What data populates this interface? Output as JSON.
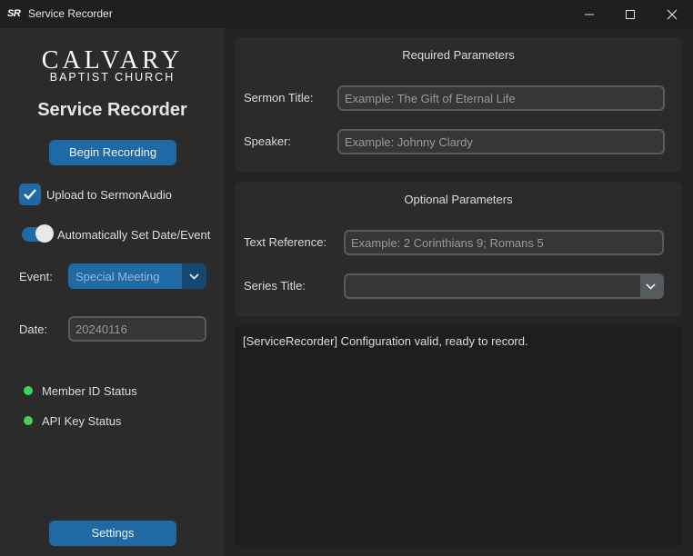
{
  "window": {
    "icon_text": "SR",
    "title": "Service Recorder"
  },
  "sidebar": {
    "logo_top": "CALVARY",
    "logo_bottom": "BAPTIST CHURCH",
    "heading": "Service Recorder",
    "begin_button": "Begin Recording",
    "upload_checkbox": {
      "label": "Upload to SermonAudio",
      "checked": true
    },
    "auto_switch": {
      "label": "Automatically Set Date/Event",
      "on": true
    },
    "event": {
      "label": "Event:",
      "value": "Special Meeting"
    },
    "date": {
      "label": "Date:",
      "value": "20240116"
    },
    "statuses": [
      {
        "label": "Member ID Status",
        "color": "#3fd35a"
      },
      {
        "label": "API Key Status",
        "color": "#3fd35a"
      }
    ],
    "settings_button": "Settings"
  },
  "required": {
    "heading": "Required Parameters",
    "sermon_title": {
      "label": "Sermon Title:",
      "placeholder": "Example: The Gift of Eternal Life"
    },
    "speaker": {
      "label": "Speaker:",
      "placeholder": "Example: Johnny Clardy"
    }
  },
  "optional": {
    "heading": "Optional Parameters",
    "text_reference": {
      "label": "Text Reference:",
      "placeholder": "Example: 2 Corinthians 9; Romans 5"
    },
    "series_title": {
      "label": "Series Title:",
      "value": ""
    }
  },
  "log": {
    "lines": [
      "[ServiceRecorder] Configuration valid, ready to record."
    ]
  },
  "colors": {
    "accent": "#1f6aa5",
    "status_ok": "#3fd35a"
  }
}
